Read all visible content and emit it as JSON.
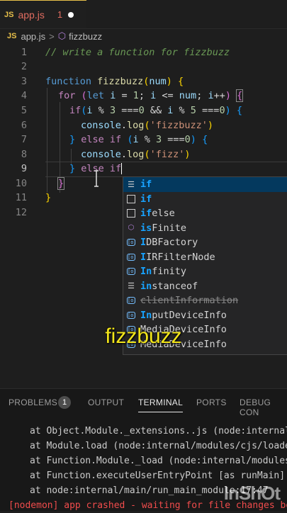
{
  "tab": {
    "badge": "JS",
    "name": "app.js",
    "problems_count": "1"
  },
  "breadcrumb": {
    "badge": "JS",
    "file": "app.js",
    "symbol": "fizzbuzz"
  },
  "editor": {
    "line_numbers": [
      "1",
      "2",
      "3",
      "4",
      "5",
      "6",
      "7",
      "8",
      "9",
      "10",
      "11",
      "12"
    ]
  },
  "suggestions": [
    {
      "icon": "keyword-icon",
      "match": "if",
      "rest": ""
    },
    {
      "icon": "snippet-icon",
      "match": "if",
      "rest": ""
    },
    {
      "icon": "snippet-icon",
      "match": "if",
      "rest": "else"
    },
    {
      "icon": "method-icon",
      "match": "is",
      "rest": "Finite"
    },
    {
      "icon": "field-icon",
      "match": "I",
      "rest": "DBFactory"
    },
    {
      "icon": "field-icon",
      "match": "I",
      "rest": "IRFilterNode"
    },
    {
      "icon": "field-icon",
      "match": "In",
      "rest": "finity"
    },
    {
      "icon": "keyword-icon",
      "match": "in",
      "rest": "stanceof"
    },
    {
      "icon": "field-icon",
      "match": "",
      "rest": "clientInformation"
    },
    {
      "icon": "field-icon",
      "match": "In",
      "rest": "putDeviceInfo"
    },
    {
      "icon": "field-icon",
      "match": "",
      "rest": "MediaDeviceInfo"
    },
    {
      "icon": "field-icon",
      "match": "",
      "rest": "MediaDeviceInfo"
    }
  ],
  "caption": "fizzbuzz",
  "panel": {
    "tabs": [
      "PROBLEMS",
      "OUTPUT",
      "TERMINAL",
      "PORTS",
      "DEBUG CON"
    ],
    "problems_badge": "1",
    "terminal_lines": [
      "at Object.Module._extensions..js (node:internal/",
      "at Module.load (node:internal/modules/cjs/loader",
      "at Function.Module._load (node:internal/modules/",
      "at Function.executeUserEntryPoint [as runMain] (",
      "at node:internal/main/run_main_module:17:47"
    ],
    "error_line": "[nodemon] app crashed - waiting for file changes bef"
  },
  "watermark": "InShOt",
  "colors": {
    "background": "#1e1e1e",
    "selection": "#04395e",
    "caption": "#f2e51a",
    "error": "#f14c4c"
  }
}
